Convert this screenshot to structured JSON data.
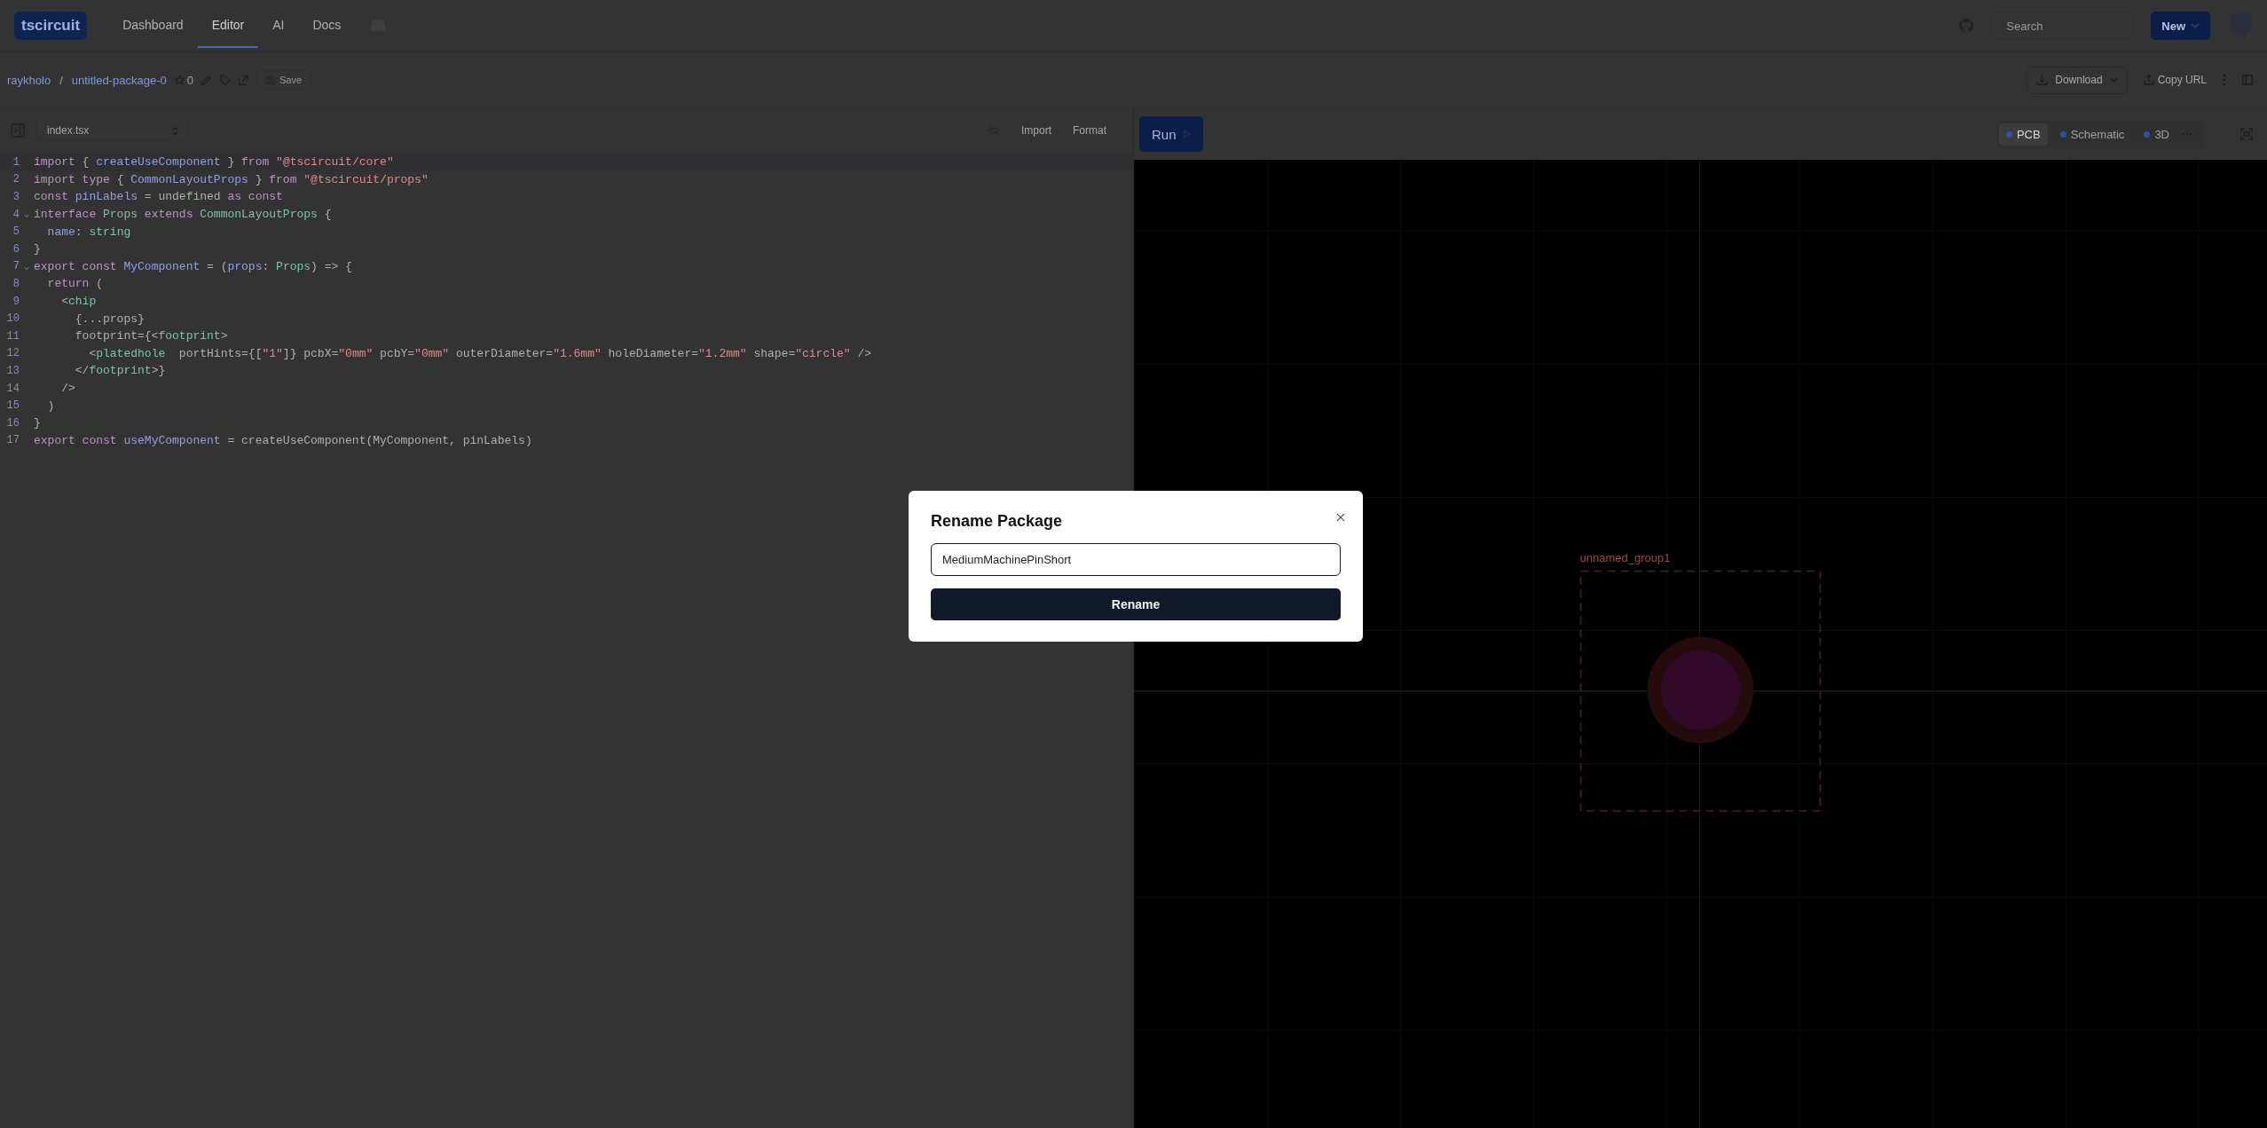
{
  "header": {
    "logo": "tscircuit",
    "nav": [
      {
        "label": "Dashboard",
        "selected": false
      },
      {
        "label": "Editor",
        "selected": true
      },
      {
        "label": "AI",
        "selected": false
      },
      {
        "label": "Docs",
        "selected": false
      }
    ],
    "search": {
      "placeholder": "Search"
    },
    "new_button": "New"
  },
  "package_bar": {
    "owner": "raykholo",
    "separator": "/",
    "package": "untitled-package-0",
    "star_count": "0",
    "save": "Save",
    "download": "Download",
    "copy_url": "Copy URL"
  },
  "editor": {
    "file": "index.tsx",
    "import": "Import",
    "format": "Format",
    "lines": [
      {
        "number": "1",
        "foldable": false,
        "tokens": [
          {
            "text": "import",
            "kind": "kw"
          },
          {
            "text": " { ",
            "kind": "plain"
          },
          {
            "text": "createUseComponent",
            "kind": "name"
          },
          {
            "text": " } ",
            "kind": "plain"
          },
          {
            "text": "from ",
            "kind": "kw"
          },
          {
            "text": "\"@tscircuit/core\"",
            "kind": "str"
          }
        ]
      },
      {
        "number": "2",
        "foldable": false,
        "tokens": [
          {
            "text": "import type",
            "kind": "kw"
          },
          {
            "text": " { ",
            "kind": "plain"
          },
          {
            "text": "CommonLayoutProps",
            "kind": "name"
          },
          {
            "text": " } ",
            "kind": "plain"
          },
          {
            "text": "from ",
            "kind": "kw"
          },
          {
            "text": "\"@tscircuit/props\"",
            "kind": "str"
          }
        ]
      },
      {
        "number": "3",
        "foldable": false,
        "tokens": [
          {
            "text": "const ",
            "kind": "kw"
          },
          {
            "text": "pinLabels",
            "kind": "name"
          },
          {
            "text": " = undefined ",
            "kind": "plain"
          },
          {
            "text": "as const",
            "kind": "kw"
          }
        ]
      },
      {
        "number": "4",
        "foldable": true,
        "tokens": [
          {
            "text": "interface ",
            "kind": "kw"
          },
          {
            "text": "Props ",
            "kind": "type"
          },
          {
            "text": "extends ",
            "kind": "kw"
          },
          {
            "text": "CommonLayoutProps",
            "kind": "type"
          },
          {
            "text": " {",
            "kind": "plain"
          }
        ]
      },
      {
        "number": "5",
        "foldable": false,
        "tokens": [
          {
            "text": "  name",
            "kind": "name"
          },
          {
            "text": ": ",
            "kind": "plain"
          },
          {
            "text": "string",
            "kind": "type"
          }
        ]
      },
      {
        "number": "6",
        "foldable": false,
        "tokens": [
          {
            "text": "}",
            "kind": "plain"
          }
        ]
      },
      {
        "number": "7",
        "foldable": true,
        "tokens": [
          {
            "text": "export const ",
            "kind": "kw"
          },
          {
            "text": "MyComponent",
            "kind": "name"
          },
          {
            "text": " = (",
            "kind": "plain"
          },
          {
            "text": "props",
            "kind": "name"
          },
          {
            "text": ": ",
            "kind": "plain"
          },
          {
            "text": "Props",
            "kind": "type"
          },
          {
            "text": ") => {",
            "kind": "plain"
          }
        ]
      },
      {
        "number": "8",
        "foldable": false,
        "tokens": [
          {
            "text": "  return",
            "kind": "kw"
          },
          {
            "text": " (",
            "kind": "plain"
          }
        ]
      },
      {
        "number": "9",
        "foldable": false,
        "tokens": [
          {
            "text": "    <",
            "kind": "plain"
          },
          {
            "text": "chip",
            "kind": "type"
          }
        ]
      },
      {
        "number": "10",
        "foldable": false,
        "tokens": [
          {
            "text": "      {...props}",
            "kind": "plain"
          }
        ]
      },
      {
        "number": "11",
        "foldable": false,
        "tokens": [
          {
            "text": "      footprint={<",
            "kind": "plain"
          },
          {
            "text": "footprint",
            "kind": "type"
          },
          {
            "text": ">",
            "kind": "plain"
          }
        ]
      },
      {
        "number": "12",
        "foldable": false,
        "tokens": [
          {
            "text": "        <",
            "kind": "plain"
          },
          {
            "text": "platedhole",
            "kind": "type"
          },
          {
            "text": "  portHints={[",
            "kind": "plain"
          },
          {
            "text": "\"1\"",
            "kind": "str"
          },
          {
            "text": "]} pcbX=",
            "kind": "plain"
          },
          {
            "text": "\"0mm\"",
            "kind": "str"
          },
          {
            "text": " pcbY=",
            "kind": "plain"
          },
          {
            "text": "\"0mm\"",
            "kind": "str"
          },
          {
            "text": " outerDiameter=",
            "kind": "plain"
          },
          {
            "text": "\"1.6mm\"",
            "kind": "str"
          },
          {
            "text": " holeDiameter=",
            "kind": "plain"
          },
          {
            "text": "\"1.2mm\"",
            "kind": "str"
          },
          {
            "text": " shape=",
            "kind": "plain"
          },
          {
            "text": "\"circle\"",
            "kind": "str"
          },
          {
            "text": " />",
            "kind": "plain"
          }
        ]
      },
      {
        "number": "13",
        "foldable": false,
        "tokens": [
          {
            "text": "      </",
            "kind": "plain"
          },
          {
            "text": "footprint",
            "kind": "type"
          },
          {
            "text": ">}",
            "kind": "plain"
          }
        ]
      },
      {
        "number": "14",
        "foldable": false,
        "tokens": [
          {
            "text": "    />",
            "kind": "plain"
          }
        ]
      },
      {
        "number": "15",
        "foldable": false,
        "tokens": [
          {
            "text": "  )",
            "kind": "plain"
          }
        ]
      },
      {
        "number": "16",
        "foldable": false,
        "tokens": [
          {
            "text": "}",
            "kind": "plain"
          }
        ]
      },
      {
        "number": "17",
        "foldable": false,
        "tokens": [
          {
            "text": "export const ",
            "kind": "kw"
          },
          {
            "text": "useMyComponent",
            "kind": "name"
          },
          {
            "text": " = createUseComponent(MyComponent, pinLabels)",
            "kind": "plain"
          }
        ]
      }
    ]
  },
  "preview": {
    "run": "Run",
    "tabs": [
      {
        "label": "PCB",
        "selected": true
      },
      {
        "label": "Schematic",
        "selected": false
      },
      {
        "label": "3D",
        "selected": false
      }
    ],
    "group_label": "unnamed_group1"
  },
  "dialog": {
    "title": "Rename Package",
    "value": "MediumMachinePinShort",
    "button": "Rename"
  }
}
